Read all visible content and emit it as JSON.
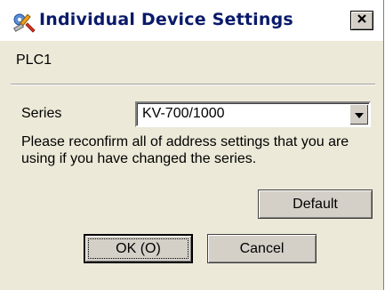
{
  "window": {
    "title": "Individual Device Settings",
    "close_glyph": "×",
    "icon": "settings-tools-icon"
  },
  "device": {
    "name": "PLC1"
  },
  "series": {
    "label": "Series",
    "selected_value": "KV-700/1000"
  },
  "message": "Please reconfirm all of address settings that you are using if you have changed the series.",
  "buttons": {
    "default_label": "Default",
    "ok_label": "OK (O)",
    "cancel_label": "Cancel"
  },
  "colors": {
    "dialog_background": "#ece9d8",
    "title_text": "#0a1a6a",
    "button_face": "#d4d0c8"
  }
}
